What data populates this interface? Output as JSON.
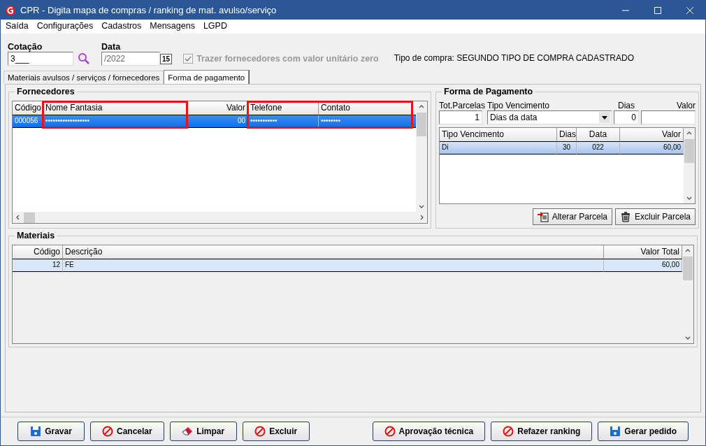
{
  "window": {
    "title": "CPR - Digita mapa de compras / ranking de mat. avulso/serviço"
  },
  "menu": [
    "Saída",
    "Configurações",
    "Cadastros",
    "Mensagens",
    "LGPD"
  ],
  "header": {
    "cotacao": {
      "label": "Cotação",
      "value": "3___"
    },
    "data": {
      "label": "Data",
      "value": "/2022",
      "calendar_button": "15"
    },
    "zero_price_option": {
      "label": "Trazer fornecedores com valor unitário zero",
      "checked": true,
      "disabled": true
    },
    "purchase_type": "Tipo de compra: SEGUNDO TIPO DE COMPRA CADASTRADO"
  },
  "tabs": [
    {
      "label": "Materiais avulsos / serviços / fornecedores",
      "selected": false
    },
    {
      "label": "Forma de pagamento",
      "selected": true
    }
  ],
  "suppliers": {
    "title": "Fornecedores",
    "focused": true,
    "columns": [
      {
        "label": "Código",
        "highlighted": false
      },
      {
        "label": "Nome Fantasia",
        "highlighted": true
      },
      {
        "label": "Valor",
        "highlighted": false
      },
      {
        "label": "Telefone",
        "highlighted": true
      },
      {
        "label": "Contato",
        "highlighted": true
      }
    ],
    "rows": [
      {
        "selected": true,
        "cells": [
          "000056",
          "••••••••••••••••••",
          "00",
          "•••••••••••",
          "••••••••"
        ]
      }
    ]
  },
  "payment": {
    "title": "Forma de Pagamento",
    "tot_parcelas": {
      "label": "Tot.Parcelas",
      "value": "1"
    },
    "tipo_vencimento": {
      "label": "Tipo Vencimento",
      "value": "Dias da data"
    },
    "dias": {
      "label": "Dias",
      "value": "0"
    },
    "valor": {
      "label": "Valor"
    },
    "focused": false,
    "columns": [
      "Tipo Vencimento",
      "Dias",
      "Data",
      "Valor"
    ],
    "rows": [
      {
        "selected": true,
        "cells": [
          "Di",
          "30",
          "022",
          "60,00"
        ]
      }
    ],
    "buttons": [
      {
        "label": "Alterar Parcela",
        "kind": "edit"
      },
      {
        "label": "Excluir Parcela",
        "kind": "trash"
      }
    ]
  },
  "materials": {
    "title": "Materiais",
    "focused": false,
    "columns": [
      "Código",
      "Descrição",
      "Valor Total"
    ],
    "rows": [
      {
        "selected": true,
        "cells": [
          "12",
          "FE",
          "60,00"
        ]
      }
    ]
  },
  "buttons_left": [
    {
      "label": "Gravar",
      "kind": "save"
    },
    {
      "label": "Cancelar",
      "kind": "cancel"
    },
    {
      "label": "Limpar",
      "kind": "eraser"
    },
    {
      "label": "Excluir",
      "kind": "cancel"
    }
  ],
  "buttons_right": [
    {
      "label": "Aprovação técnica",
      "kind": "cancel"
    },
    {
      "label": "Refazer ranking",
      "kind": "cancel"
    },
    {
      "label": "Gerar pedido",
      "kind": "save"
    }
  ]
}
